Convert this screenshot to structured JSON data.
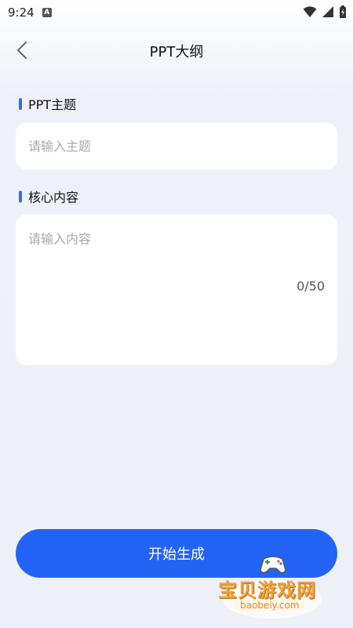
{
  "status_bar": {
    "time": "9:24",
    "notification_icon": "A"
  },
  "header": {
    "title": "PPT大纲",
    "back_icon": "chevron-left-icon"
  },
  "topic_section": {
    "label": "PPT主题",
    "placeholder": "请输入主题",
    "value": ""
  },
  "content_section": {
    "label": "核心内容",
    "placeholder": "请输入内容",
    "value": "",
    "counter": "0/50"
  },
  "actions": {
    "generate_label": "开始生成"
  },
  "watermark": {
    "title": "宝贝游戏网",
    "url": "baobeiy.com"
  },
  "colors": {
    "accent": "#2f6df6",
    "button": "#2364f6",
    "background": "#eef0f7"
  }
}
